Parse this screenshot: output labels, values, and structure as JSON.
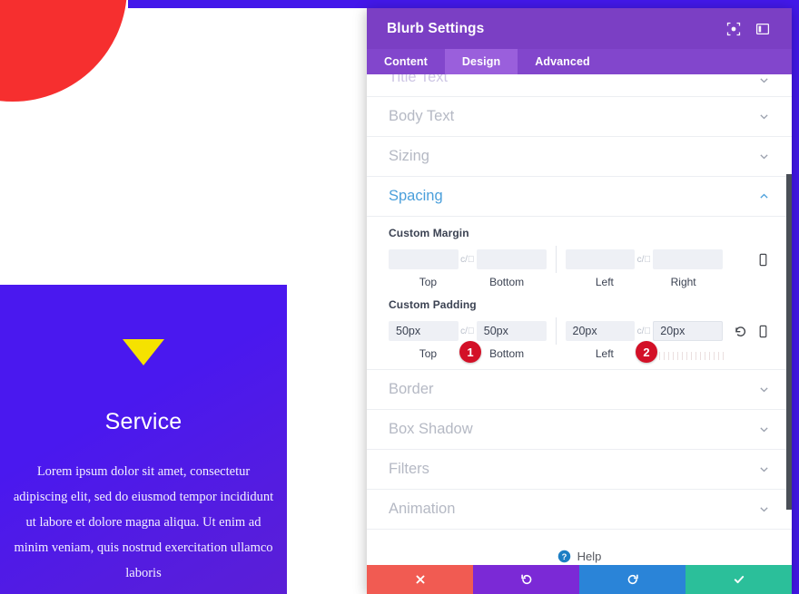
{
  "preview": {
    "blurb": {
      "icon_name": "triangle-down-icon",
      "title": "Service",
      "body": "Lorem ipsum dolor sit amet, consectetur adipiscing elit, sed do eiusmod tempor incididunt ut labore et dolore magna aliqua. Ut enim ad minim veniam, quis nostrud exercitation ullamco laboris"
    },
    "colors": {
      "blurb_bg": "#4a18ef",
      "page_accent_blue": "#4318ea",
      "circle_red": "#f62f2f",
      "icon_yellow": "#f5e200"
    }
  },
  "modal": {
    "title": "Blurb Settings",
    "header_icons": [
      {
        "name": "focus-icon"
      },
      {
        "name": "panel-layout-icon"
      }
    ],
    "tabs": [
      {
        "label": "Content",
        "active": false
      },
      {
        "label": "Design",
        "active": true
      },
      {
        "label": "Advanced",
        "active": false
      }
    ],
    "sections": {
      "clipped_top": {
        "label": "Title Text"
      },
      "before": [
        {
          "label": "Body Text"
        },
        {
          "label": "Sizing"
        }
      ],
      "open": {
        "label": "Spacing"
      },
      "after": [
        {
          "label": "Border"
        },
        {
          "label": "Box Shadow"
        },
        {
          "label": "Filters"
        },
        {
          "label": "Animation"
        }
      ]
    },
    "spacing": {
      "margin": {
        "label": "Custom Margin",
        "top": {
          "value": "",
          "placeholder": "",
          "caption": "Top"
        },
        "bottom": {
          "value": "",
          "placeholder": "",
          "caption": "Bottom"
        },
        "left": {
          "value": "",
          "placeholder": "",
          "caption": "Left"
        },
        "right": {
          "value": "",
          "placeholder": "",
          "caption": "Right"
        },
        "link_icon": "broken-link-icon",
        "device_icon": "mobile-device-icon"
      },
      "padding": {
        "label": "Custom Padding",
        "top": {
          "value": "50px",
          "placeholder": "",
          "caption": "Top"
        },
        "bottom": {
          "value": "50px",
          "placeholder": "",
          "caption": "Bottom"
        },
        "left": {
          "value": "20px",
          "placeholder": "",
          "caption": "Left"
        },
        "right": {
          "value": "20px",
          "placeholder": "",
          "caption": "Right"
        },
        "link_icon": "broken-link-icon",
        "reset_icon": "reset-icon",
        "device_icon": "mobile-device-icon"
      }
    },
    "annotations": [
      {
        "number": "1"
      },
      {
        "number": "2"
      }
    ],
    "help": {
      "label": "Help",
      "icon": "question-circle-icon"
    },
    "footer": [
      {
        "name": "cancel-button",
        "icon": "close-icon",
        "color": "#f15b52"
      },
      {
        "name": "undo-button",
        "icon": "undo-icon",
        "color": "#7b29d6"
      },
      {
        "name": "redo-button",
        "icon": "redo-icon",
        "color": "#2a84d8"
      },
      {
        "name": "save-button",
        "icon": "check-icon",
        "color": "#2bbf9a"
      }
    ]
  }
}
